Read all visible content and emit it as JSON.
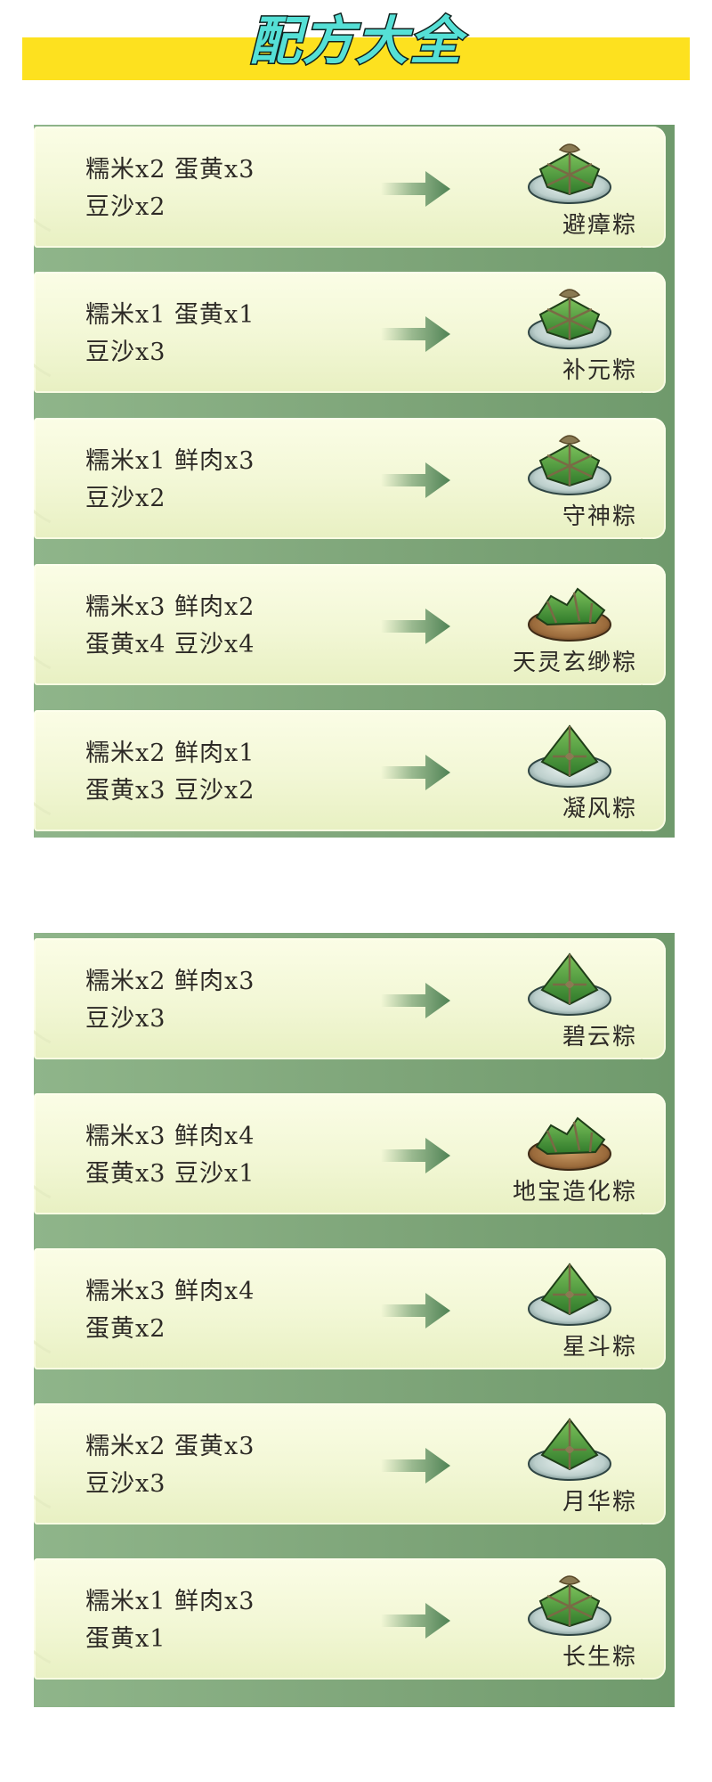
{
  "title": "配方大全",
  "sections": [
    {
      "recipes": [
        {
          "line1": "糯米x2  蛋黄x3",
          "line2": "豆沙x2",
          "name": "避瘴粽",
          "icon": "square-zongzi-on-plate"
        },
        {
          "line1": "糯米x1  蛋黄x1",
          "line2": "豆沙x3",
          "name": "补元粽",
          "icon": "square-zongzi-on-plate"
        },
        {
          "line1": "糯米x1  鲜肉x3",
          "line2": "豆沙x2",
          "name": "守神粽",
          "icon": "square-zongzi-on-plate"
        },
        {
          "line1": "糯米x3  鲜肉x2",
          "line2": "蛋黄x4  豆沙x4",
          "name": "天灵玄缈粽",
          "icon": "long-zongzi-on-wood-plate"
        },
        {
          "line1": "糯米x2  鲜肉x1",
          "line2": "蛋黄x3  豆沙x2",
          "name": "凝风粽",
          "icon": "pyramid-zongzi-on-plate"
        }
      ]
    },
    {
      "recipes": [
        {
          "line1": "糯米x2  鲜肉x3",
          "line2": "豆沙x3",
          "name": "碧云粽",
          "icon": "pyramid-zongzi-on-plate"
        },
        {
          "line1": "糯米x3  鲜肉x4",
          "line2": "蛋黄x3  豆沙x1",
          "name": "地宝造化粽",
          "icon": "long-zongzi-on-wood-plate"
        },
        {
          "line1": "糯米x3  鲜肉x4",
          "line2": "蛋黄x2",
          "name": "星斗粽",
          "icon": "pyramid-zongzi-on-plate"
        },
        {
          "line1": "糯米x2  蛋黄x3",
          "line2": "豆沙x3",
          "name": "月华粽",
          "icon": "pyramid-zongzi-on-plate"
        },
        {
          "line1": "糯米x1  鲜肉x3",
          "line2": "蛋黄x1",
          "name": "长生粽",
          "icon": "square-zongzi-on-plate"
        }
      ]
    }
  ],
  "colors": {
    "banner": "#fde11f",
    "title_fill": "#55e0d6",
    "panel": "#82a87d",
    "arrow": "#5e8f60",
    "leaf": "#4a9a3a"
  }
}
